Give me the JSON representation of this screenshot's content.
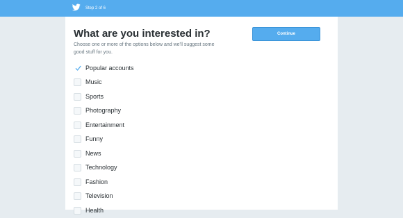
{
  "header": {
    "step_text": "Step 2 of 6",
    "logo_icon": "twitter-bird-icon",
    "brand_color": "#55acee"
  },
  "main": {
    "title": "What are you interested in?",
    "subtitle": "Choose one or more of the options below and we'll suggest some good stuff for you.",
    "continue_label": "Continue"
  },
  "interests": [
    {
      "label": "Popular accounts",
      "checked": true
    },
    {
      "label": "Music",
      "checked": false
    },
    {
      "label": "Sports",
      "checked": false
    },
    {
      "label": "Photography",
      "checked": false
    },
    {
      "label": "Entertainment",
      "checked": false
    },
    {
      "label": "Funny",
      "checked": false
    },
    {
      "label": "News",
      "checked": false
    },
    {
      "label": "Technology",
      "checked": false
    },
    {
      "label": "Fashion",
      "checked": false
    },
    {
      "label": "Television",
      "checked": false
    },
    {
      "label": "Health",
      "checked": false
    }
  ]
}
